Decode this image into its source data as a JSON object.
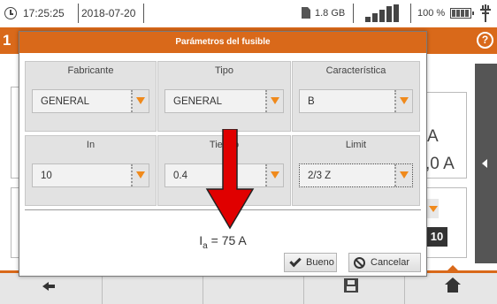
{
  "status_bar": {
    "time": "17:25:25",
    "date": "2018-07-20",
    "storage": "1.8 GB",
    "battery": "100 %"
  },
  "background_screen": {
    "number": "1",
    "values": [
      "A",
      ",0 A",
      "10"
    ]
  },
  "dialog": {
    "title": "Parámetros del fusible",
    "fields": [
      {
        "label": "Fabricante",
        "value": "GENERAL"
      },
      {
        "label": "Tipo",
        "value": "GENERAL"
      },
      {
        "label": "Característica",
        "value": "B"
      },
      {
        "label": "In",
        "value": "10"
      },
      {
        "label": "Tiempo",
        "visible_label": "Tie    o",
        "value": "0.4"
      },
      {
        "label": "Limit",
        "value": "2/3 Z"
      }
    ],
    "result": {
      "symbol": "I",
      "subscript": "a",
      "value": "= 75 A"
    },
    "ok_label": "Bueno",
    "cancel_label": "Cancelar"
  },
  "colors": {
    "accent": "#d9691a",
    "dropdown_arrow": "#f08a1c",
    "annotation_arrow": "#e00000"
  },
  "icons": [
    "clock-icon",
    "sd-card-icon",
    "signal-icon",
    "battery-icon",
    "plug-icon",
    "help-icon",
    "check-icon",
    "cancel-icon",
    "back-icon",
    "save-icon",
    "home-icon",
    "red-arrow"
  ]
}
